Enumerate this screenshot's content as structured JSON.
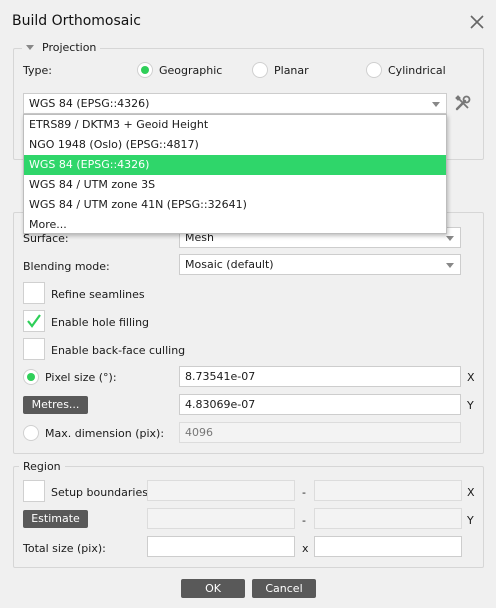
{
  "window": {
    "title": "Build Orthomosaic"
  },
  "projection": {
    "section_label": "Projection",
    "type_label": "Type:",
    "types": [
      {
        "label": "Geographic",
        "selected": true
      },
      {
        "label": "Planar",
        "selected": false
      },
      {
        "label": "Cylindrical",
        "selected": false
      }
    ],
    "crs_value": "WGS 84 (EPSG::4326)",
    "dropdown_items": [
      {
        "label": "ETRS89 / DKTM3 + Geoid Height",
        "selected": false
      },
      {
        "label": "NGO 1948 (Oslo) (EPSG::4817)",
        "selected": false
      },
      {
        "label": "WGS 84 (EPSG::4326)",
        "selected": true
      },
      {
        "label": "WGS 84 / UTM zone 3S",
        "selected": false
      },
      {
        "label": "WGS 84 / UTM zone 41N (EPSG::32641)",
        "selected": false
      },
      {
        "label": "More...",
        "selected": false
      }
    ]
  },
  "parameters": {
    "surface_label": "Surface:",
    "surface_value": "Mesh",
    "blending_label": "Blending mode:",
    "blending_value": "Mosaic (default)",
    "refine_seamlines": {
      "label": "Refine seamlines",
      "checked": false
    },
    "hole_filling": {
      "label": "Enable hole filling",
      "checked": true
    },
    "back_face_culling": {
      "label": "Enable back-face culling",
      "checked": false
    },
    "pixel_size_label": "Pixel size (°):",
    "pixel_x": "8.73541e-07",
    "pixel_y": "4.83069e-07",
    "x_label": "X",
    "y_label": "Y",
    "metres_button": "Metres...",
    "max_dimension_label": "Max. dimension (pix):",
    "max_dimension_value": "4096"
  },
  "region": {
    "section_label": "Region",
    "setup_boundaries_label": "Setup boundaries:",
    "estimate_button": "Estimate",
    "dash": "-",
    "x_label": "X",
    "y_label": "Y",
    "total_size_label": "Total size (pix):",
    "times": "x"
  },
  "footer": {
    "ok_button": "OK",
    "cancel_button": "Cancel"
  },
  "colors": {
    "accent": "#2fd66a",
    "button_dark": "#595959",
    "background": "#f0f0f0"
  },
  "icons": {
    "close": "close-icon",
    "tools": "tools-icon",
    "collapse": "triangle-down-icon",
    "checkmark": "checkmark-icon"
  }
}
